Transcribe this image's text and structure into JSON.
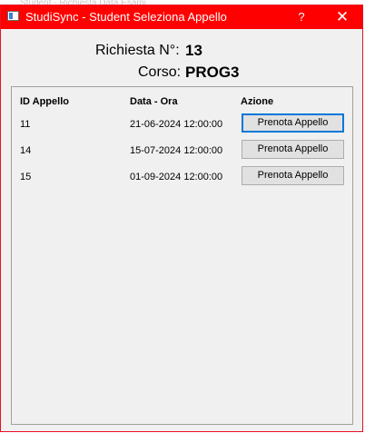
{
  "background_window": {
    "title": "Student - Richiesta Data Esami"
  },
  "window": {
    "title": "StudiSync - Student Seleziona Appello",
    "help_label": "?",
    "close_label": "✕",
    "accent_color": "#ff0000"
  },
  "header": {
    "request_label": "Richiesta N°:",
    "request_value": "13",
    "course_label": "Corso:",
    "course_value": "PROG3"
  },
  "table": {
    "columns": [
      "ID Appello",
      "Data - Ora",
      "Azione"
    ],
    "rows": [
      {
        "id": "11",
        "datetime": "21-06-2024 12:00:00",
        "action": "Prenota Appello"
      },
      {
        "id": "14",
        "datetime": "15-07-2024 12:00:00",
        "action": "Prenota Appello"
      },
      {
        "id": "15",
        "datetime": "01-09-2024 12:00:00",
        "action": "Prenota Appello"
      }
    ]
  }
}
